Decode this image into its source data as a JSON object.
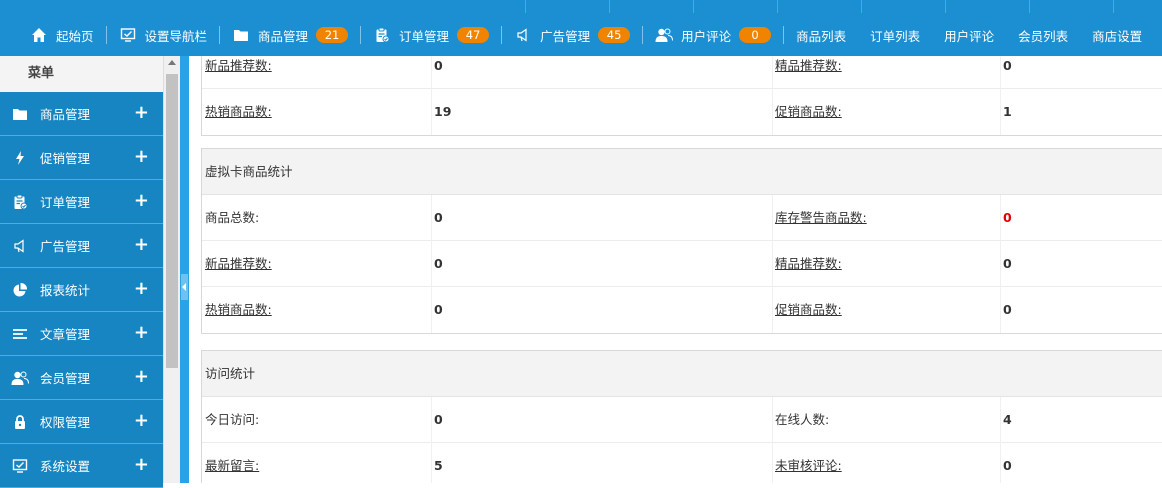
{
  "topnav": {
    "items": [
      {
        "label": "起始页",
        "icon": "home-icon"
      },
      {
        "label": "设置导航栏",
        "icon": "monitor-check-icon"
      },
      {
        "label": "商品管理",
        "icon": "folder-icon",
        "badge": "21"
      },
      {
        "label": "订单管理",
        "icon": "clipboard-icon",
        "badge": "47"
      },
      {
        "label": "广告管理",
        "icon": "megaphone-icon",
        "badge": "45"
      },
      {
        "label": "用户评论",
        "icon": "users-icon",
        "badge": "0"
      }
    ],
    "links": [
      "商品列表",
      "订单列表",
      "用户评论",
      "会员列表",
      "商店设置"
    ]
  },
  "sidebar": {
    "title": "菜单",
    "items": [
      {
        "label": "商品管理",
        "icon": "folder-icon"
      },
      {
        "label": "促销管理",
        "icon": "lightning-icon"
      },
      {
        "label": "订单管理",
        "icon": "clipboard-icon"
      },
      {
        "label": "广告管理",
        "icon": "megaphone-icon"
      },
      {
        "label": "报表统计",
        "icon": "pie-chart-icon"
      },
      {
        "label": "文章管理",
        "icon": "lines-icon"
      },
      {
        "label": "会员管理",
        "icon": "users-icon"
      },
      {
        "label": "权限管理",
        "icon": "lock-icon"
      },
      {
        "label": "系统设置",
        "icon": "monitor-check-icon"
      }
    ]
  },
  "goods_stats_tail": {
    "rows": [
      {
        "l1": "新品推荐数:",
        "v1": "0",
        "l2": "精品推荐数:",
        "v2": "0"
      },
      {
        "l1": "热销商品数:",
        "v1": "19",
        "l2": "促销商品数:",
        "v2": "1"
      }
    ]
  },
  "virtual_card_stats": {
    "title": "虚拟卡商品统计",
    "rows": [
      {
        "l1": "商品总数:",
        "v1": "0",
        "l2": "库存警告商品数:",
        "v2": "0"
      },
      {
        "l1": "新品推荐数:",
        "v1": "0",
        "l2": "精品推荐数:",
        "v2": "0"
      },
      {
        "l1": "热销商品数:",
        "v1": "0",
        "l2": "促销商品数:",
        "v2": "0"
      }
    ]
  },
  "visit_stats": {
    "title": "访问统计",
    "rows": [
      {
        "l1": "今日访问:",
        "v1": "0",
        "l2": "在线人数:",
        "v2": "4"
      },
      {
        "l1": "最新留言:",
        "v1": "5",
        "l2": "未审核评论:",
        "v2": "0"
      }
    ]
  },
  "colors": {
    "topbar": "#1b8fd1",
    "sidebar_item": "#1785c2",
    "badge": "#f08400",
    "warning": "#e00000"
  }
}
